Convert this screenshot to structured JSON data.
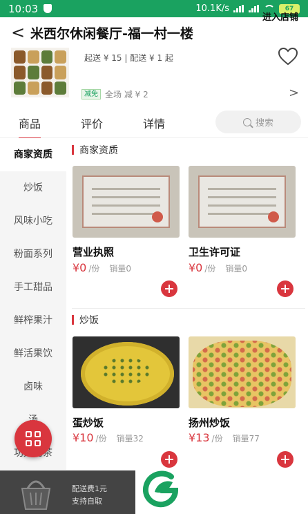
{
  "status_bar": {
    "time": "10:03",
    "network_speed": "10.1K/s",
    "battery": "67"
  },
  "header": {
    "back_label": "<",
    "title": "米西尔休闲餐厅-福一村一楼",
    "enter_store": "进入店铺"
  },
  "shop": {
    "delivery_info": "起送 ¥ 15 | 配送 ¥ 1 起",
    "promo_tag": "减免",
    "promo_text": "全场 减 ¥ 2",
    "promo_arrow": ">"
  },
  "tabs": [
    {
      "label": "商品",
      "active": true
    },
    {
      "label": "评价",
      "active": false
    },
    {
      "label": "详情",
      "active": false
    }
  ],
  "search": {
    "placeholder": "搜索"
  },
  "sidebar": {
    "items": [
      {
        "label": "商家资质",
        "active": true
      },
      {
        "label": "炒饭"
      },
      {
        "label": "风味小吃"
      },
      {
        "label": "粉面系列"
      },
      {
        "label": "手工甜品"
      },
      {
        "label": "鲜榨果汁"
      },
      {
        "label": "鲜活果饮"
      },
      {
        "label": "卤味"
      },
      {
        "label": "汤"
      },
      {
        "label": "功夫奶茶"
      }
    ]
  },
  "sections": [
    {
      "title": "商家资质",
      "products": [
        {
          "name": "营业执照",
          "price": "¥0",
          "unit": "/份",
          "sales": "销量0"
        },
        {
          "name": "卫生许可证",
          "price": "¥0",
          "unit": "/份",
          "sales": "销量0"
        }
      ]
    },
    {
      "title": "炒饭",
      "products": [
        {
          "name": "蛋炒饭",
          "price": "¥10",
          "unit": "/份",
          "sales": "销量32"
        },
        {
          "name": "扬州炒饭",
          "price": "¥13",
          "unit": "/份",
          "sales": "销量77"
        }
      ]
    }
  ],
  "cart": {
    "delivery_fee": "配送费1元",
    "pickup": "支持自取"
  },
  "colors": {
    "status_green": "#1aa260",
    "accent_red": "#d9363e",
    "cart_dark": "#444444"
  }
}
